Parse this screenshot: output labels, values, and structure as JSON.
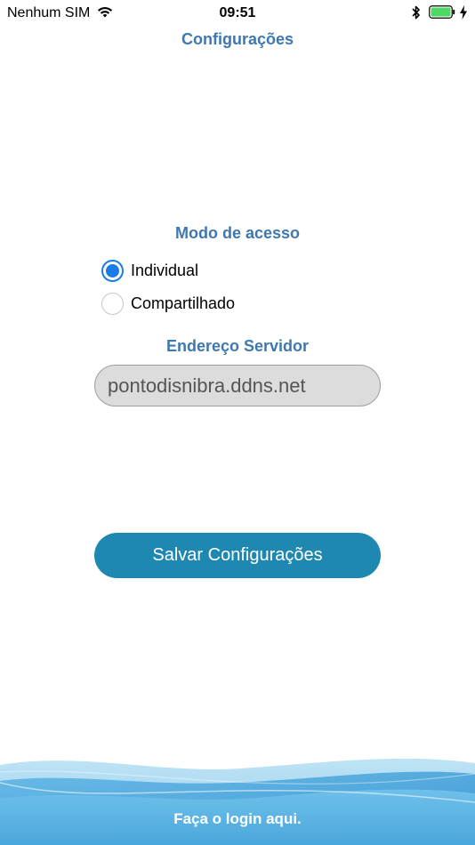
{
  "status_bar": {
    "carrier": "Nenhum SIM",
    "time": "09:51",
    "icons": [
      "wifi-icon",
      "bluetooth-icon",
      "battery-icon",
      "charging-icon"
    ],
    "battery_level": 1.0
  },
  "header": {
    "title": "Configurações"
  },
  "access_mode": {
    "title": "Modo de acesso",
    "options": [
      {
        "label": "Individual",
        "selected": true
      },
      {
        "label": "Compartilhado",
        "selected": false
      }
    ]
  },
  "server": {
    "title": "Endereço Servidor",
    "value": "pontodisnibra.ddns.net"
  },
  "save_button": {
    "label": "Salvar Configurações"
  },
  "footer": {
    "login_label": "Faça o login aqui."
  },
  "colors": {
    "accent": "#3d78b0",
    "button": "#1e88b1",
    "radio": "#1a7de6",
    "battery": "#4cd964"
  }
}
